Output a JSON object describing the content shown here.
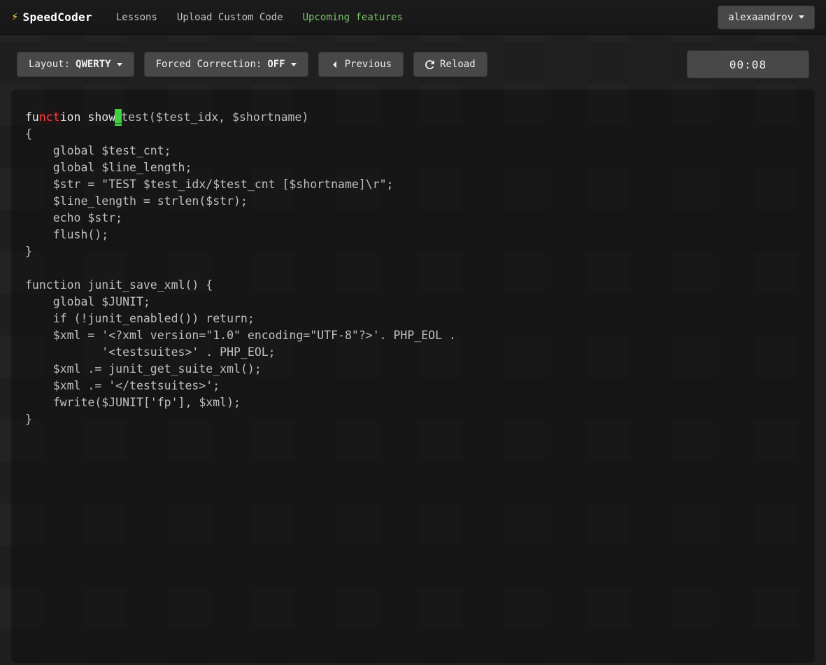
{
  "nav": {
    "brand": "SpeedCoder",
    "links": {
      "lessons": "Lessons",
      "uploadCustom": "Upload Custom Code",
      "upcoming": "Upcoming features"
    },
    "user": "alexaandrov"
  },
  "toolbar": {
    "layout": {
      "label": "Layout:",
      "value": "QWERTY"
    },
    "forcedCorrection": {
      "label": "Forced Correction:",
      "value": "OFF"
    },
    "previous": "Previous",
    "reload": "Reload",
    "timer": "00:08"
  },
  "typing": {
    "typedCorrectPrefix": "fu",
    "typedErrorSegment": "nct",
    "typedCorrectSuffix": "ion show",
    "cursorChar": "_",
    "restOfFirstLine": "test($test_idx, $shortname)",
    "remainingLines": "{\n    global $test_cnt;\n    global $line_length;\n    $str = \"TEST $test_idx/$test_cnt [$shortname]\\r\";\n    $line_length = strlen($str);\n    echo $str;\n    flush();\n}\n\nfunction junit_save_xml() {\n    global $JUNIT;\n    if (!junit_enabled()) return;\n    $xml = '<?xml version=\"1.0\" encoding=\"UTF-8\"?>'. PHP_EOL .\n           '<testsuites>' . PHP_EOL;\n    $xml .= junit_get_suite_xml();\n    $xml .= '</testsuites>';\n    fwrite($JUNIT['fp'], $xml);\n}"
  }
}
